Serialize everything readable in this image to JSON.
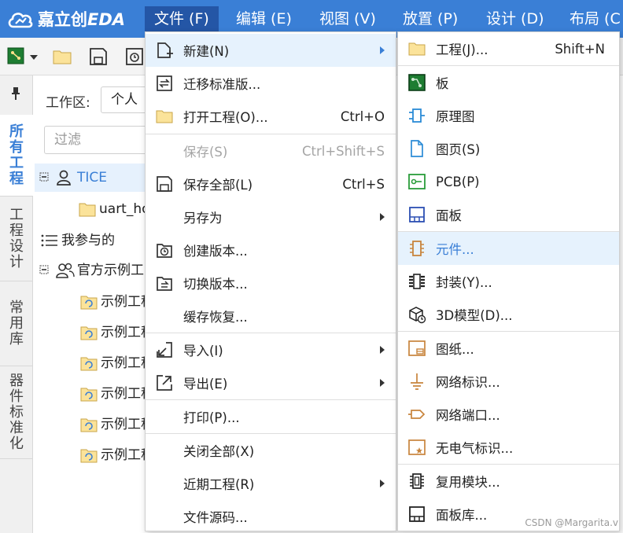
{
  "app": {
    "logo_text_cn": "嘉立创",
    "logo_text_en": "EDA"
  },
  "menubar": [
    {
      "label": "文件 (F)",
      "active": true
    },
    {
      "label": "编辑 (E)"
    },
    {
      "label": "视图 (V)"
    },
    {
      "label": "放置 (P)"
    },
    {
      "label": "设计 (D)"
    },
    {
      "label": "布局 (C"
    }
  ],
  "left_tabs": [
    "所有工程",
    "工程设计",
    "常用库",
    "器件标准化"
  ],
  "workspace": {
    "label": "工作区:",
    "value": "个人",
    "filter_placeholder": "过滤"
  },
  "tree": [
    {
      "label": "TICE",
      "highlight": true
    },
    {
      "label": "uart_ho"
    },
    {
      "label": "我参与的"
    },
    {
      "label": "官方示例工"
    },
    {
      "label": "示例工程"
    },
    {
      "label": "示例工程"
    },
    {
      "label": "示例工程"
    },
    {
      "label": "示例工程"
    },
    {
      "label": "示例工程"
    },
    {
      "label": "示例工程"
    }
  ],
  "file_menu": [
    {
      "label": "新建(N)",
      "shortcut": "",
      "icon": "new-file-icon",
      "submenu": true,
      "highlight": true
    },
    {
      "label": "迁移标准版...",
      "shortcut": "",
      "icon": "migrate-icon"
    },
    {
      "label": "打开工程(O)...",
      "shortcut": "Ctrl+O",
      "icon": "folder-icon"
    },
    {
      "label": "保存(S)",
      "shortcut": "Ctrl+Shift+S",
      "icon": "",
      "disabled": true
    },
    {
      "label": "保存全部(L)",
      "shortcut": "Ctrl+S",
      "icon": "save-all-icon"
    },
    {
      "label": "另存为",
      "shortcut": "",
      "icon": "",
      "submenu": true
    },
    {
      "label": "创建版本...",
      "shortcut": "",
      "icon": "create-version-icon"
    },
    {
      "label": "切换版本...",
      "shortcut": "",
      "icon": "switch-version-icon"
    },
    {
      "label": "缓存恢复...",
      "shortcut": "",
      "icon": ""
    },
    {
      "label": "导入(I)",
      "shortcut": "",
      "icon": "import-icon",
      "submenu": true
    },
    {
      "label": "导出(E)",
      "shortcut": "",
      "icon": "export-icon",
      "submenu": true
    },
    {
      "label": "打印(P)...",
      "shortcut": "",
      "icon": ""
    },
    {
      "label": "关闭全部(X)",
      "shortcut": "",
      "icon": ""
    },
    {
      "label": "近期工程(R)",
      "shortcut": "",
      "icon": "",
      "submenu": true
    },
    {
      "label": "文件源码...",
      "shortcut": "",
      "icon": ""
    }
  ],
  "new_submenu": [
    {
      "label": "工程(J)...",
      "shortcut": "Shift+N",
      "icon": "folder-icon"
    },
    {
      "label": "板",
      "icon": "board-icon"
    },
    {
      "label": "原理图",
      "icon": "schematic-icon"
    },
    {
      "label": "图页(S)",
      "icon": "page-icon"
    },
    {
      "label": "PCB(P)",
      "icon": "pcb-icon"
    },
    {
      "label": "面板",
      "icon": "panel-icon"
    },
    {
      "label": "元件...",
      "icon": "component-icon",
      "highlight": true
    },
    {
      "label": "封装(Y)...",
      "icon": "footprint-icon"
    },
    {
      "label": "3D模型(D)...",
      "icon": "3d-model-icon"
    },
    {
      "label": "图纸...",
      "icon": "drawing-icon"
    },
    {
      "label": "网络标识...",
      "icon": "net-label-icon"
    },
    {
      "label": "网络端口...",
      "icon": "net-port-icon"
    },
    {
      "label": "无电气标识...",
      "icon": "non-electrical-icon"
    },
    {
      "label": "复用模块...",
      "icon": "reuse-module-icon"
    },
    {
      "label": "面板库...",
      "icon": "panel-library-icon"
    }
  ],
  "watermark": "CSDN @Margarita.v",
  "colors": {
    "accent": "#3a7fd6",
    "menubar": "#3a7fd6",
    "active_menu": "#2456a6",
    "highlight": "#e6f2fd",
    "orange": "#c8843c",
    "green": "#2a9d3a"
  }
}
